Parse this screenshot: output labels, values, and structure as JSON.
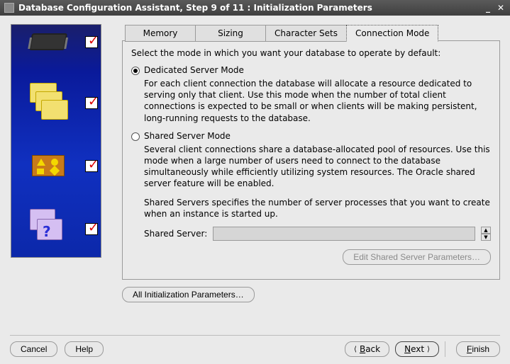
{
  "window": {
    "title": "Database Configuration Assistant, Step 9 of 11 : Initialization Parameters"
  },
  "tabs": {
    "memory": "Memory",
    "sizing": "Sizing",
    "char_sets": "Character Sets",
    "conn_mode": "Connection Mode"
  },
  "content": {
    "intro": "Select the mode in which you want your database to operate by default:",
    "dedicated": {
      "label": "Dedicated Server Mode",
      "desc": "For each client connection the database will allocate a resource dedicated to serving only that client.  Use this mode when the number of total client connections is expected to be small or when clients will be making persistent, long-running requests to the database."
    },
    "shared": {
      "label": "Shared Server Mode",
      "desc": "Several client connections share a database-allocated pool of resources.  Use this mode when a large number of users need to connect to the database simultaneously while efficiently utilizing system resources.  The Oracle shared server feature will be enabled.",
      "extra": "Shared Servers specifies the number of server processes that you want to create when an instance is started up.",
      "field_label": "Shared Server:",
      "field_value": ""
    },
    "edit_button": "Edit Shared Server Parameters…"
  },
  "main_extra": {
    "all_params": "All Initialization Parameters…"
  },
  "buttons": {
    "cancel": "Cancel",
    "help": "Help",
    "back": "Back",
    "next": "Next",
    "finish": "Finish"
  }
}
